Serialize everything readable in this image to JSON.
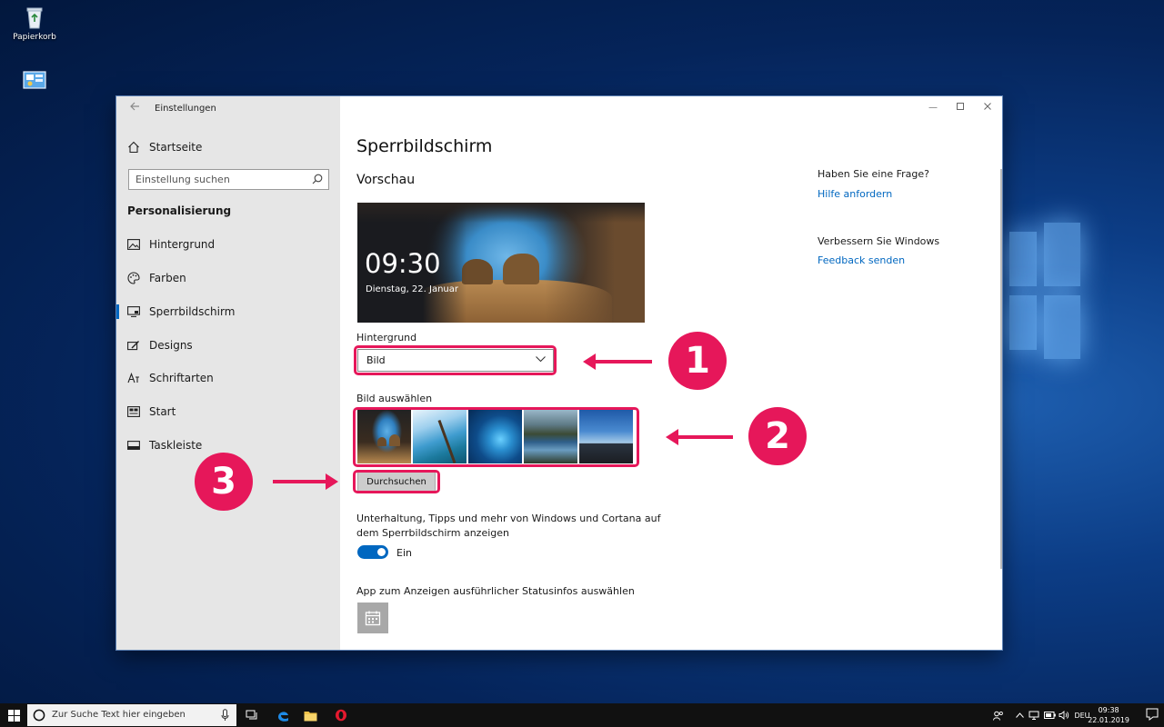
{
  "desktop": {
    "recycle_bin_label": "Papierkorb"
  },
  "window": {
    "title": "Einstellungen",
    "sidebar": {
      "home_label": "Startseite",
      "search_placeholder": "Einstellung suchen",
      "section_title": "Personalisierung",
      "items": [
        {
          "label": "Hintergrund",
          "icon": "image-icon"
        },
        {
          "label": "Farben",
          "icon": "palette-icon"
        },
        {
          "label": "Sperrbildschirm",
          "icon": "lockscreen-icon",
          "active": true
        },
        {
          "label": "Designs",
          "icon": "brush-icon"
        },
        {
          "label": "Schriftarten",
          "icon": "font-icon"
        },
        {
          "label": "Start",
          "icon": "start-icon"
        },
        {
          "label": "Taskleiste",
          "icon": "taskbar-icon"
        }
      ]
    },
    "main": {
      "page_title": "Sperrbildschirm",
      "preview_label": "Vorschau",
      "preview_time": "09:30",
      "preview_date": "Dienstag, 22. Januar",
      "background_label": "Hintergrund",
      "background_value": "Bild",
      "choose_image_label": "Bild auswählen",
      "browse_label": "Durchsuchen",
      "toggle_description": "Unterhaltung, Tipps und mehr von Windows und Cortana auf dem Sperrbildschirm anzeigen",
      "toggle_state": "Ein",
      "toggle_on": true,
      "status_app_label": "App zum Anzeigen ausführlicher Statusinfos auswählen"
    },
    "help": {
      "question": "Haben Sie eine Frage?",
      "get_help": "Hilfe anfordern",
      "improve": "Verbessern Sie Windows",
      "feedback": "Feedback senden"
    }
  },
  "annotations": {
    "badge_1": "1",
    "badge_2": "2",
    "badge_3": "3",
    "color": "#e6175a"
  },
  "taskbar": {
    "search_placeholder": "Zur Suche Text hier eingeben",
    "language": "DEU",
    "time": "09:38",
    "date": "22.01.2019"
  }
}
